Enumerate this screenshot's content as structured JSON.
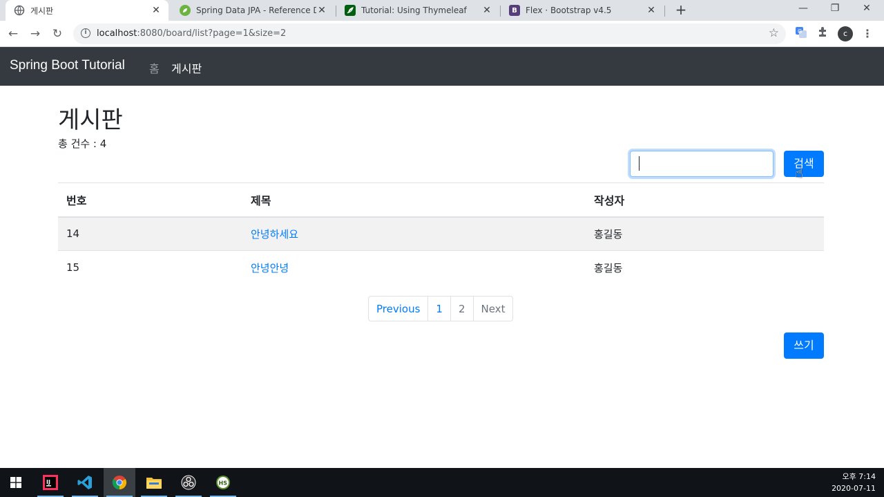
{
  "browser": {
    "tabs": [
      {
        "title": "게시판",
        "active": true
      },
      {
        "title": "Spring Data JPA - Reference Do",
        "active": false
      },
      {
        "title": "Tutorial: Using Thymeleaf",
        "active": false
      },
      {
        "title": "Flex · Bootstrap v4.5",
        "active": false
      }
    ],
    "url_host": "localhost",
    "url_rest": ":8080/board/list?page=1&size=2",
    "profile_initial": "c"
  },
  "navbar": {
    "brand": "Spring Boot Tutorial",
    "links": [
      {
        "label": "홈",
        "active": false
      },
      {
        "label": "게시판",
        "active": true
      }
    ]
  },
  "page": {
    "title": "게시판",
    "total_label": "총 건수 : 4",
    "search_value": "",
    "search_button": "검색",
    "write_button": "쓰기"
  },
  "table": {
    "headers": [
      "번호",
      "제목",
      "작성자"
    ],
    "rows": [
      {
        "no": "14",
        "title": "안녕하세요",
        "author": "홍길동"
      },
      {
        "no": "15",
        "title": "안녕안녕",
        "author": "홍길동"
      }
    ]
  },
  "pagination": {
    "previous": "Previous",
    "pages": [
      "1",
      "2"
    ],
    "next": "Next"
  },
  "taskbar": {
    "time": "오후 7:14",
    "date": "2020-07-11"
  },
  "colors": {
    "primary": "#007bff",
    "navbar_bg": "#343a40",
    "taskbar_bg": "#101418"
  }
}
